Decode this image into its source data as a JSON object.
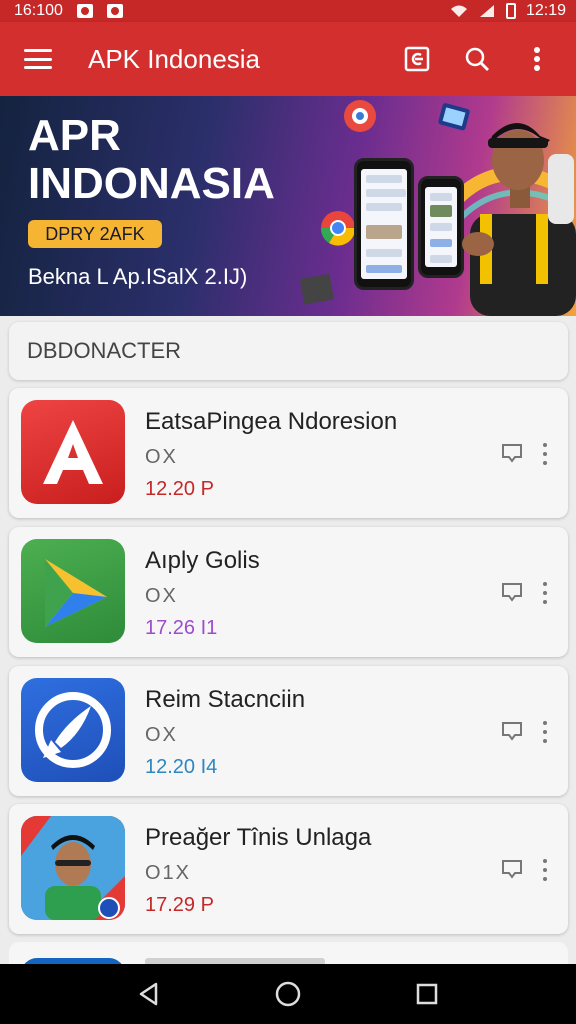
{
  "status_bar": {
    "time": "16:100",
    "clock_right": "12:19"
  },
  "app_bar": {
    "title": "APK Indonesia"
  },
  "banner": {
    "title": "APR INDONASIA",
    "badge": "DPRY 2AFK",
    "subtitle": "Bekna L Ap.ISalX 2.IJ)"
  },
  "section": {
    "header": "DBDONACTER"
  },
  "apps": [
    {
      "name": "EatsaPingea Ndoresion",
      "meta": "OX",
      "size": "12.20 P",
      "size_color": "#c62828"
    },
    {
      "name": "Aıply Golis",
      "meta": "OX",
      "size": "17.26 I1",
      "size_color": "#9c4dcc"
    },
    {
      "name": "Reim Stacnciin",
      "meta": "OX",
      "size": "12.20 I4",
      "size_color": "#2e86c1"
    },
    {
      "name": "Preağer Tînis Unlaga",
      "meta": "O1X",
      "size": "17.29 P",
      "size_color": "#c62828"
    }
  ],
  "colors": {
    "primary": "#d32f2f",
    "status": "#c62828",
    "badge": "#f5b533"
  },
  "icons": [
    "menu-icon",
    "share-icon",
    "search-icon",
    "more-vert-icon",
    "download-icon",
    "back-icon",
    "home-icon",
    "recents-icon"
  ]
}
